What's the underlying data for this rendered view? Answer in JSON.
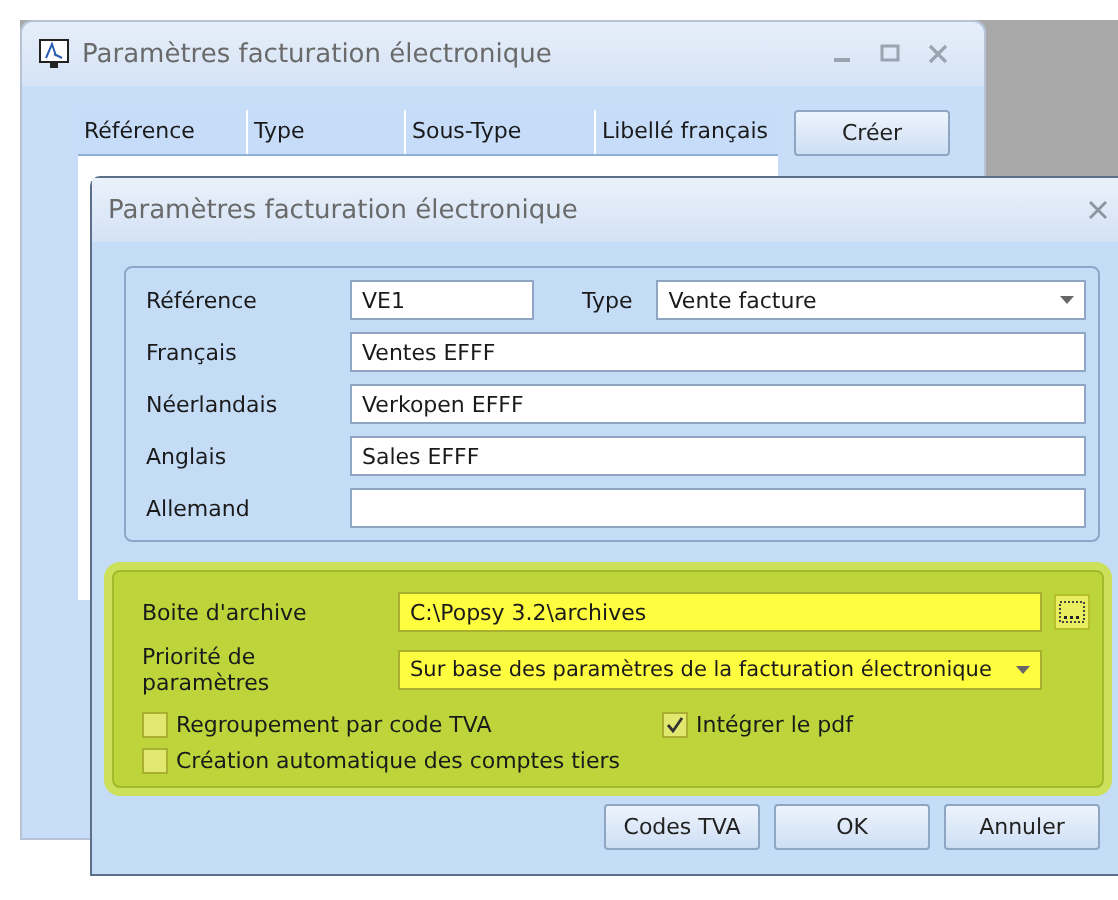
{
  "main_window": {
    "title": "Paramètres facturation électronique",
    "table": {
      "columns": [
        "Référence",
        "Type",
        "Sous-Type",
        "Libellé français"
      ]
    },
    "buttons": [
      "Créer"
    ]
  },
  "dialog": {
    "title": "Paramètres facturation électronique",
    "reference": {
      "label": "Référence",
      "value": "VE1"
    },
    "type": {
      "label": "Type",
      "value": "Vente facture"
    },
    "languages": [
      {
        "label": "Français",
        "value": "Ventes EFFF"
      },
      {
        "label": "Néerlandais",
        "value": "Verkopen EFFF"
      },
      {
        "label": "Anglais",
        "value": "Sales EFFF"
      },
      {
        "label": "Allemand"
      }
    ],
    "archive": {
      "label": "Boite d'archive",
      "value": "C:\\Popsy 3.2\\archives"
    },
    "priority": {
      "label": "Priorité de paramètres",
      "value": "Sur base des paramètres de la facturation électronique"
    },
    "options": [
      {
        "label": "Regroupement par code TVA",
        "checked": false
      },
      {
        "label": "Intégrer le pdf",
        "checked": true
      },
      {
        "label": "Création automatique des comptes tiers",
        "checked": false
      }
    ],
    "buttons": [
      "Codes TVA",
      "OK",
      "Annuler"
    ]
  }
}
